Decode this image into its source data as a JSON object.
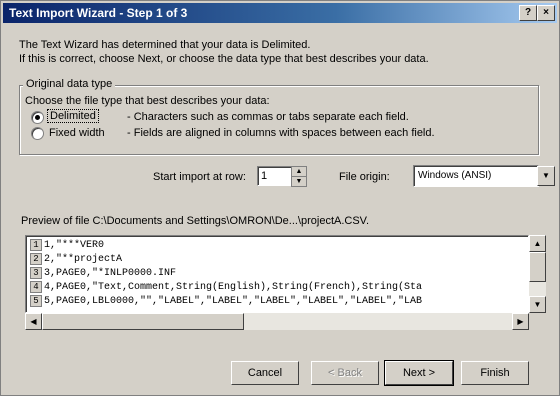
{
  "window": {
    "title": "Text Import Wizard - Step 1 of 3",
    "help_label": "?",
    "close_label": "×"
  },
  "intro": {
    "line1": "The Text Wizard has determined that your data is Delimited.",
    "line2": "If this is correct, choose Next, or choose the data type that best describes your data."
  },
  "original_data_type": {
    "legend": "Original data type",
    "prompt": "Choose the file type that best describes your data:",
    "options": [
      {
        "label": "Delimited",
        "description": "- Characters such as commas or tabs separate each field.",
        "selected": true
      },
      {
        "label": "Fixed width",
        "description": "- Fields are aligned in columns with spaces between each field.",
        "selected": false
      }
    ]
  },
  "start_row": {
    "label": "Start import at row:",
    "value": "1",
    "up_icon": "spin-up-icon",
    "down_icon": "spin-down-icon"
  },
  "file_origin": {
    "label": "File origin:",
    "value": "Windows (ANSI)",
    "dropdown_icon": "chevron-down-icon"
  },
  "preview": {
    "label": "Preview of file C:\\Documents and Settings\\OMRON\\De...\\projectA.CSV.",
    "rows": [
      {
        "num": "1",
        "text": "1,\"***VER0"
      },
      {
        "num": "2",
        "text": "2,\"**projectA"
      },
      {
        "num": "3",
        "text": "3,PAGE0,\"*INLP0000.INF"
      },
      {
        "num": "4",
        "text": "4,PAGE0,\"Text,Comment,String(English),String(French),String(Sta"
      },
      {
        "num": "5",
        "text": "5,PAGE0,LBL0000,\"\",\"LABEL\",\"LABEL\",\"LABEL\",\"LABEL\",\"LABEL\",\"LAB"
      }
    ]
  },
  "buttons": {
    "cancel": "Cancel",
    "back": "< Back",
    "next": "Next >",
    "finish": "Finish"
  },
  "colors": {
    "dialog_bg": "#d4d0c8",
    "title_start": "#0a246a",
    "title_end": "#a6caf0"
  }
}
